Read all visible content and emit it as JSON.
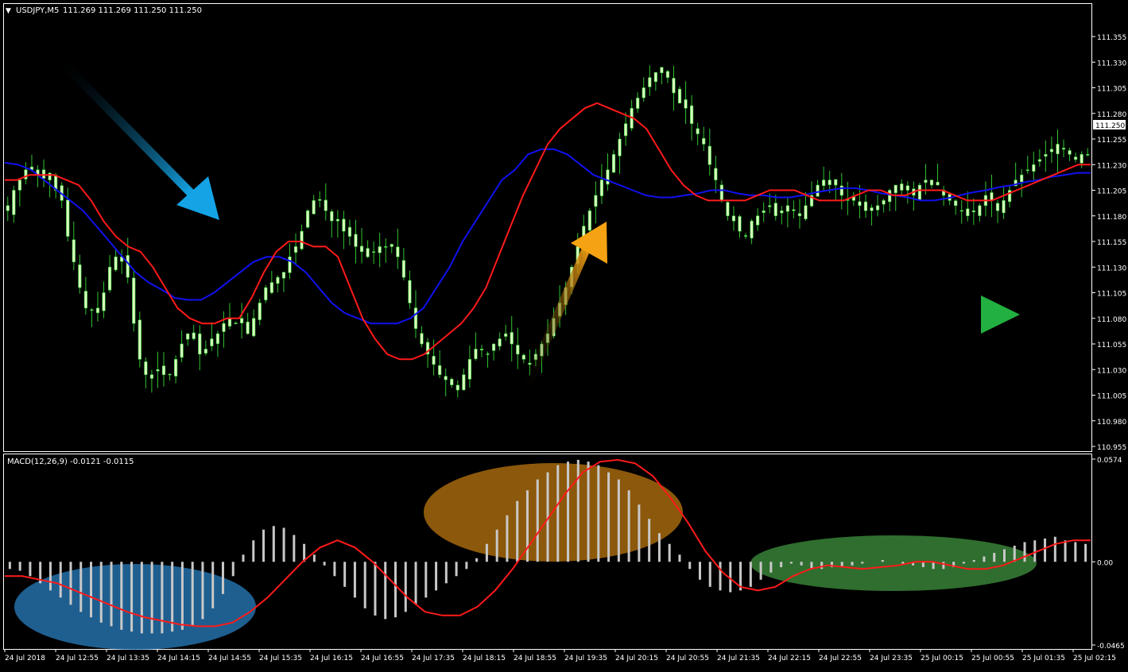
{
  "header": {
    "symbol_label": "USDJPY,M5",
    "ohlc_text": "111.269 111.269 111.250 111.250",
    "menu_icon": "triangle-down-icon"
  },
  "current_price_label": "111.250",
  "macd_label": "MACD(12,26,9) -0.0121 -0.0115",
  "colors": {
    "background": "#000000",
    "frame": "#ffffff",
    "candle": "#d8ffbe",
    "wick": "#2fc42f",
    "ma_fast": "#ff1a1a",
    "ma_slow": "#1111ee",
    "histogram": "#c8c8c8",
    "signal": "#ff1a1a",
    "arrow_down": "#14a4e6",
    "arrow_up": "#f5a213",
    "arrow_right": "#22b040",
    "ellipse_blue": "#2a7fc0",
    "ellipse_orange": "#c77e10",
    "ellipse_green": "#3b8a3b"
  },
  "icons": {
    "arrow_down": "diagonal-down-arrow-icon",
    "arrow_up": "diagonal-up-arrow-icon",
    "arrow_right": "right-arrow-icon"
  },
  "chart_data": [
    {
      "type": "candlestick",
      "title": "USDJPY,M5",
      "ylim": [
        110.94,
        111.36
      ],
      "y_ticks": [
        "111.355",
        "111.330",
        "111.305",
        "111.280",
        "111.255",
        "111.230",
        "111.205",
        "111.180",
        "111.155",
        "111.130",
        "111.105",
        "111.080",
        "111.055",
        "111.030",
        "111.005",
        "110.980",
        "110.955"
      ],
      "x_ticks": [
        "24 Jul 2018",
        "24 Jul 12:55",
        "24 Jul 13:35",
        "24 Jul 14:15",
        "24 Jul 14:55",
        "24 Jul 15:35",
        "24 Jul 16:15",
        "24 Jul 16:55",
        "24 Jul 17:35",
        "24 Jul 18:15",
        "24 Jul 18:55",
        "24 Jul 19:35",
        "24 Jul 20:15",
        "24 Jul 20:55",
        "24 Jul 21:35",
        "24 Jul 22:15",
        "24 Jul 22:55",
        "24 Jul 23:35",
        "25 Jul 00:15",
        "25 Jul 00:55",
        "25 Jul 01:35",
        "25 Jul 02:15"
      ],
      "close_series": [
        111.185,
        111.205,
        111.215,
        111.225,
        111.225,
        111.22,
        111.225,
        111.215,
        111.205,
        111.195,
        111.16,
        111.135,
        111.11,
        111.09,
        111.088,
        111.09,
        111.105,
        111.13,
        111.14,
        111.14,
        111.12,
        111.075,
        111.04,
        111.025,
        111.025,
        111.03,
        111.025,
        111.025,
        111.04,
        111.055,
        111.065,
        111.06,
        111.045,
        111.05,
        111.06,
        111.065,
        111.075,
        111.08,
        111.075,
        111.08,
        111.065,
        111.08,
        111.095,
        111.11,
        111.115,
        111.12,
        111.125,
        111.14,
        111.15,
        111.165,
        111.185,
        111.195,
        111.195,
        111.185,
        111.175,
        111.175,
        111.165,
        111.16,
        111.15,
        111.145,
        111.14,
        111.145,
        111.15,
        111.15,
        111.15,
        111.14,
        111.12,
        111.095,
        111.07,
        111.055,
        111.045,
        111.035,
        111.025,
        111.02,
        111.015,
        111.01,
        111.025,
        111.04,
        111.05,
        111.05,
        111.045,
        111.055,
        111.06,
        111.065,
        111.055,
        111.045,
        111.04,
        111.035,
        111.045,
        111.055,
        111.065,
        111.08,
        111.095,
        111.11,
        111.13,
        111.15,
        111.17,
        111.185,
        111.2,
        111.215,
        111.225,
        111.24,
        111.255,
        111.27,
        111.285,
        111.295,
        111.305,
        111.315,
        111.32,
        111.325,
        111.315,
        111.3,
        111.29,
        111.285,
        111.27,
        111.26,
        111.25,
        111.23,
        111.215,
        111.195,
        111.18,
        111.175,
        111.165,
        111.16,
        111.175,
        111.18,
        111.185,
        111.19,
        111.18,
        111.185,
        111.19,
        111.185,
        111.18,
        111.19,
        111.2,
        111.21,
        111.215,
        111.215,
        111.21,
        111.2,
        111.195,
        111.195,
        111.19,
        111.185,
        111.185,
        111.19,
        111.195,
        111.205,
        111.21,
        111.205,
        111.205,
        111.2,
        111.21,
        111.215,
        111.215,
        111.21,
        111.2,
        111.195,
        111.19,
        111.185,
        111.18,
        111.185,
        111.19,
        111.2,
        111.195,
        111.185,
        111.195,
        111.205,
        111.215,
        111.22,
        111.225,
        111.23,
        111.235,
        111.24,
        111.245,
        111.25,
        111.245,
        111.24,
        111.235,
        111.24,
        111.24
      ],
      "ma_fast": [
        111.215,
        111.215,
        111.22,
        111.22,
        111.22,
        111.215,
        111.21,
        111.195,
        111.175,
        111.16,
        111.15,
        111.145,
        111.13,
        111.11,
        111.09,
        111.08,
        111.075,
        111.075,
        111.08,
        111.08,
        111.1,
        111.125,
        111.145,
        111.155,
        111.155,
        111.15,
        111.15,
        111.14,
        111.11,
        111.08,
        111.06,
        111.045,
        111.04,
        111.04,
        111.045,
        111.055,
        111.065,
        111.075,
        111.09,
        111.11,
        111.14,
        111.17,
        111.2,
        111.225,
        111.25,
        111.265,
        111.275,
        111.285,
        111.29,
        111.285,
        111.28,
        111.275,
        111.265,
        111.245,
        111.225,
        111.21,
        111.2,
        111.195,
        111.195,
        111.195,
        111.195,
        111.2,
        111.205,
        111.205,
        111.205,
        111.2,
        111.195,
        111.195,
        111.195,
        111.2,
        111.205,
        111.205,
        111.2,
        111.2,
        111.205,
        111.205,
        111.205,
        111.2,
        111.195,
        111.195,
        111.195,
        111.2,
        111.205,
        111.21,
        111.215,
        111.22,
        111.225,
        111.23,
        111.23
      ],
      "ma_slow": [
        111.232,
        111.23,
        111.225,
        111.215,
        111.205,
        111.195,
        111.185,
        111.17,
        111.155,
        111.14,
        111.125,
        111.115,
        111.108,
        111.1,
        111.098,
        111.098,
        111.105,
        111.115,
        111.125,
        111.135,
        111.14,
        111.14,
        111.135,
        111.125,
        111.11,
        111.095,
        111.085,
        111.08,
        111.075,
        111.075,
        111.075,
        111.08,
        111.09,
        111.11,
        111.13,
        111.155,
        111.175,
        111.195,
        111.215,
        111.225,
        111.24,
        111.245,
        111.245,
        111.24,
        111.23,
        111.22,
        111.215,
        111.21,
        111.205,
        111.2,
        111.198,
        111.198,
        111.2,
        111.202,
        111.205,
        111.205,
        111.202,
        111.2,
        111.2,
        111.198,
        111.198,
        111.2,
        111.203,
        111.205,
        111.207,
        111.207,
        111.205,
        111.202,
        111.2,
        111.198,
        111.195,
        111.195,
        111.197,
        111.2,
        111.203,
        111.205,
        111.208,
        111.21,
        111.213,
        111.215,
        111.218,
        111.22,
        111.222,
        111.222
      ],
      "ma_legend": "none"
    },
    {
      "type": "bar",
      "title": "MACD(12,26,9)",
      "series": [
        {
          "name": "MACD",
          "values": [
            -0.004,
            -0.005,
            -0.008,
            -0.012,
            -0.016,
            -0.02,
            -0.024,
            -0.028,
            -0.031,
            -0.034,
            -0.036,
            -0.038,
            -0.039,
            -0.04,
            -0.04,
            -0.04,
            -0.039,
            -0.038,
            -0.036,
            -0.032,
            -0.026,
            -0.018,
            -0.008,
            0.004,
            0.012,
            0.018,
            0.02,
            0.019,
            0.015,
            0.01,
            0.004,
            -0.002,
            -0.008,
            -0.014,
            -0.02,
            -0.026,
            -0.03,
            -0.032,
            -0.031,
            -0.028,
            -0.024,
            -0.02,
            -0.016,
            -0.012,
            -0.008,
            -0.004,
            0.002,
            0.01,
            0.018,
            0.026,
            0.034,
            0.04,
            0.046,
            0.05,
            0.054,
            0.056,
            0.057,
            0.056,
            0.054,
            0.05,
            0.046,
            0.04,
            0.032,
            0.024,
            0.016,
            0.01,
            0.004,
            -0.004,
            -0.01,
            -0.014,
            -0.016,
            -0.017,
            -0.016,
            -0.014,
            -0.01,
            -0.006,
            -0.003,
            -0.001,
            -0.002,
            -0.004,
            -0.004,
            -0.003,
            -0.003,
            -0.002,
            -0.001,
            0.0,
            0.001,
            0.0,
            -0.001,
            -0.002,
            -0.003,
            -0.004,
            -0.004,
            -0.003,
            -0.001,
            0.001,
            0.003,
            0.005,
            0.007,
            0.009,
            0.011,
            0.012,
            0.013,
            0.014,
            0.012,
            0.011,
            0.01
          ]
        },
        {
          "name": "Signal",
          "values": [
            -0.008,
            -0.008,
            -0.01,
            -0.012,
            -0.016,
            -0.02,
            -0.024,
            -0.028,
            -0.031,
            -0.033,
            -0.035,
            -0.036,
            -0.036,
            -0.034,
            -0.028,
            -0.02,
            -0.01,
            0.0,
            0.008,
            0.012,
            0.008,
            0.0,
            -0.01,
            -0.02,
            -0.028,
            -0.03,
            -0.03,
            -0.025,
            -0.016,
            -0.004,
            0.01,
            0.024,
            0.038,
            0.05,
            0.056,
            0.057,
            0.055,
            0.048,
            0.036,
            0.022,
            0.006,
            -0.006,
            -0.014,
            -0.016,
            -0.014,
            -0.008,
            -0.004,
            -0.002,
            -0.003,
            -0.004,
            -0.003,
            -0.002,
            0.0,
            0.0,
            -0.002,
            -0.004,
            -0.004,
            -0.002,
            0.002,
            0.006,
            0.01,
            0.012,
            0.012
          ]
        }
      ],
      "ylim": [
        -0.0465,
        0.0574
      ],
      "y_ticks": [
        "0.0574",
        "0.00",
        "-0.0465"
      ]
    }
  ]
}
